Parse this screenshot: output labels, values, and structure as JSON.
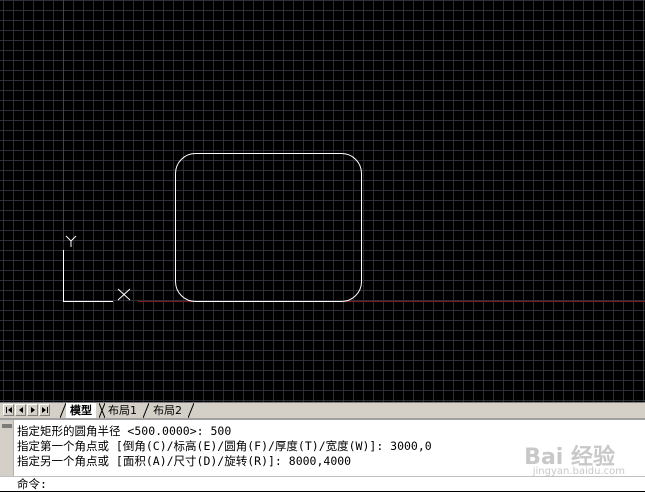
{
  "tabs": {
    "model": "模型",
    "layout1": "布局1",
    "layout2": "布局2"
  },
  "ucs": {
    "x_label": "X",
    "y_label": "Y"
  },
  "command_history": [
    "指定矩形的圆角半径 <500.0000>: 500",
    "指定第一个角点或 [倒角(C)/标高(E)/圆角(F)/厚度(T)/宽度(W)]: 3000,0",
    "指定另一个角点或 [面积(A)/尺寸(D)/旋转(R)]: 8000,4000"
  ],
  "command_prompt": "命令:",
  "watermark": {
    "brand": "Bai 经验",
    "url": "jingyan.baidu.com"
  },
  "colors": {
    "canvas_bg": "#000000",
    "grid": "#2c2f37",
    "x_axis": "#7a1a1a",
    "y_axis": "#1f5a1f",
    "entity": "#ffffff"
  }
}
